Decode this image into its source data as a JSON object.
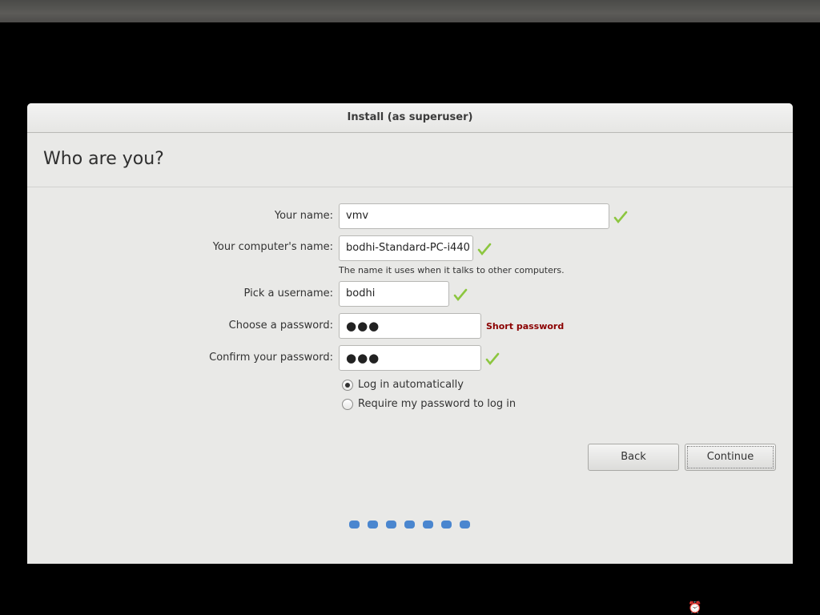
{
  "window": {
    "title": "Install (as superuser)"
  },
  "page": {
    "heading": "Who are you?"
  },
  "form": {
    "name_label": "Your name:",
    "name_value": "vmv",
    "computer_label": "Your computer's name:",
    "computer_value": "bodhi-Standard-PC-i440",
    "computer_hint": "The name it uses when it talks to other computers.",
    "username_label": "Pick a username:",
    "username_value": "bodhi",
    "password_label": "Choose a password:",
    "password_value": "●●●",
    "password_strength": "Short password",
    "confirm_label": "Confirm your password:",
    "confirm_value": "●●●",
    "login_auto_label": "Log in automatically",
    "login_password_label": "Require my password to log in",
    "login_mode_selected": "auto"
  },
  "buttons": {
    "back": "Back",
    "continue": "Continue"
  },
  "progress": {
    "total_steps": 7,
    "color": "#4a86cf"
  },
  "colors": {
    "check": "#8cc63f",
    "warning": "#8b0000"
  },
  "icons": {
    "validation": "checkmark-icon",
    "tray": "alarm-clock-icon"
  }
}
